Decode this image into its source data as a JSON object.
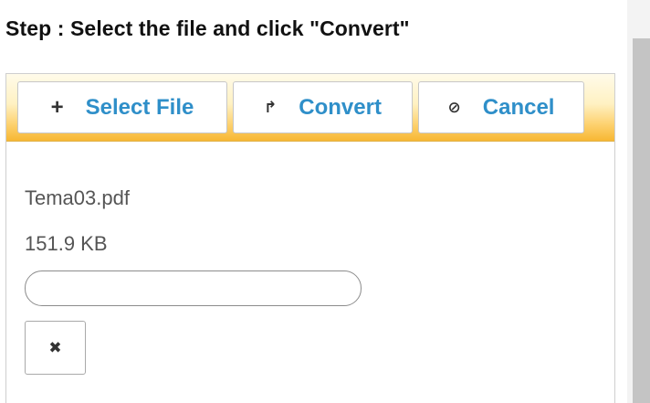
{
  "step_title": "Step : Select the file and click \"Convert\"",
  "toolbar": {
    "select_file": {
      "icon": "plus-icon",
      "glyph": "+",
      "label": "Select File"
    },
    "convert": {
      "icon": "upload-arrow-icon",
      "glyph": "↱",
      "label": "Convert"
    },
    "cancel": {
      "icon": "cancel-icon",
      "glyph": "⊘",
      "label": "Cancel"
    }
  },
  "file": {
    "name": "Tema03.pdf",
    "size": "151.9 KB",
    "progress": 0,
    "remove_glyph": "✖",
    "remove_icon": "close-icon"
  },
  "colors": {
    "accent_text": "#2f8fc9",
    "toolbar_gradient_end": "#f7b733"
  }
}
